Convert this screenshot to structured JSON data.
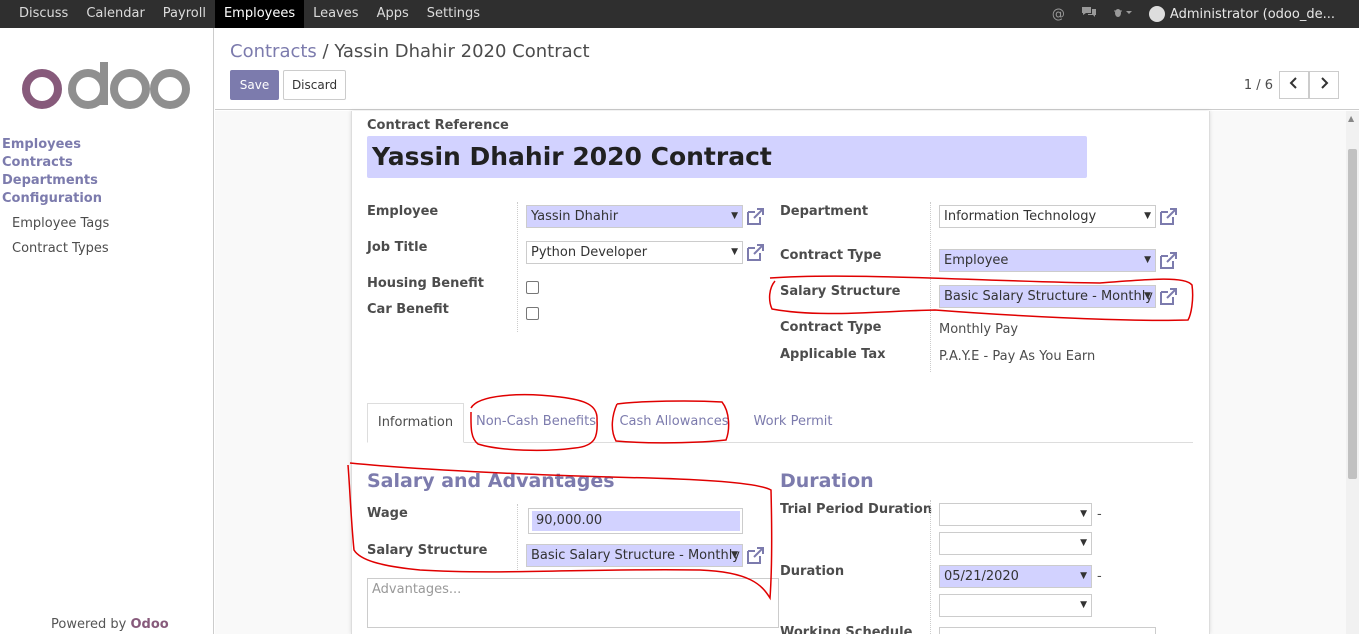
{
  "topbar": {
    "menu": [
      "Discuss",
      "Calendar",
      "Payroll",
      "Employees",
      "Leaves",
      "Apps",
      "Settings"
    ],
    "active_index": 3,
    "user": "Administrator (odoo_de..."
  },
  "sidebar": {
    "logo_text": "odoo",
    "main_items": [
      "Employees",
      "Contracts",
      "Departments",
      "Configuration"
    ],
    "sub_items": [
      "Employee Tags",
      "Contract Types"
    ],
    "powered_prefix": "Powered by",
    "powered_brand": "Odoo"
  },
  "control": {
    "breadcrumb_link": "Contracts",
    "breadcrumb_sep": "/",
    "breadcrumb_current": "Yassin Dhahir 2020 Contract",
    "save_label": "Save",
    "discard_label": "Discard",
    "pager": "1 / 6"
  },
  "form": {
    "reference_label": "Contract Reference",
    "reference_value": "Yassin Dhahir 2020 Contract",
    "employee_label": "Employee",
    "employee_value": "Yassin Dhahir",
    "job_label": "Job Title",
    "job_value": "Python Developer",
    "housing_label": "Housing Benefit",
    "car_label": "Car Benefit",
    "department_label": "Department",
    "department_value": "Information Technology",
    "contract_type_label": "Contract Type",
    "contract_type_value": "Employee",
    "salary_structure_label": "Salary Structure",
    "salary_structure_value": "Basic Salary Structure - Monthly P",
    "contract_type2_label": "Contract Type",
    "contract_type2_value": "Monthly Pay",
    "tax_label": "Applicable Tax",
    "tax_value": "P.A.Y.E - Pay As You Earn"
  },
  "tabs": [
    "Information",
    "Non-Cash Benefits",
    "Cash Allowances",
    "Work Permit"
  ],
  "salary": {
    "heading": "Salary and Advantages",
    "wage_label": "Wage",
    "wage_value": "90,000.00",
    "structure_label": "Salary Structure",
    "structure_value": "Basic Salary Structure - Monthly P",
    "advantages_placeholder": "Advantages..."
  },
  "duration": {
    "heading": "Duration",
    "trial_label": "Trial Period Duration",
    "duration_label": "Duration",
    "duration_start": "05/21/2020",
    "schedule_label": "Working Schedule",
    "dash": "-"
  },
  "colors": {
    "accent": "#7c7bad",
    "required_bg": "#d2d2ff",
    "annotation": "#e00000"
  }
}
